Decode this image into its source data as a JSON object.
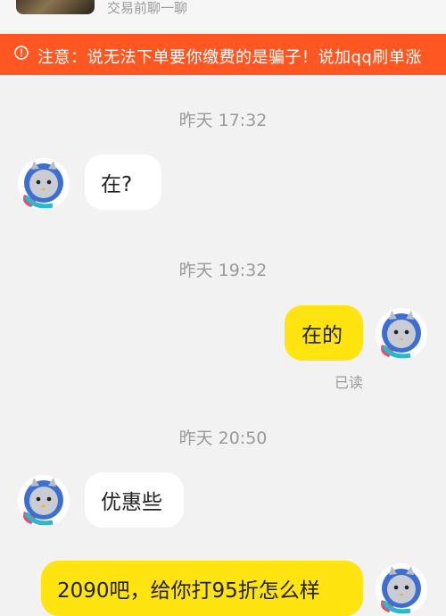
{
  "header": {
    "hint": "交易前聊一聊"
  },
  "warning": {
    "icon": "alert-circle-icon",
    "text": "注意：说无法下单要你缴费的是骗子！说加qq刷单涨"
  },
  "colors": {
    "warning_bg": "#ff5722",
    "outgoing_bubble": "#ffe40f",
    "incoming_bubble": "#ffffff",
    "background": "#f2f2f2"
  },
  "chat": {
    "ts1": "昨天 17:32",
    "msg1": "在?",
    "ts2": "昨天 19:32",
    "msg2": "在的",
    "read_status": "已读",
    "ts3": "昨天 20:50",
    "msg3": "优惠些",
    "msg4": "2090吧，给你打95折怎么样"
  }
}
